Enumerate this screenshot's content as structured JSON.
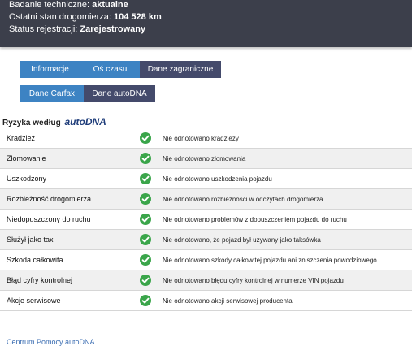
{
  "header": {
    "inspection_label": "Badanie techniczne:",
    "inspection_value": "aktualne",
    "odometer_label": "Ostatni stan drogomierza:",
    "odometer_value": "104 528 km",
    "registration_label": "Status rejestracji:",
    "registration_value": "Zarejestrowany"
  },
  "tabs_primary": [
    "Informacje",
    "Oś czasu",
    "Dane zagraniczne"
  ],
  "tabs_secondary": [
    "Dane Carfax",
    "Dane autoDNA"
  ],
  "section": {
    "title": "Ryzyka według",
    "brand": "autoDNA"
  },
  "risks": [
    {
      "label": "Kradzież",
      "status_icon": "check-circle-icon",
      "description": "Nie odnotowano kradzieży"
    },
    {
      "label": "Złomowanie",
      "status_icon": "check-circle-icon",
      "description": "Nie odnotowano złomowania"
    },
    {
      "label": "Uszkodzony",
      "status_icon": "check-circle-icon",
      "description": "Nie odnotowano uszkodzenia pojazdu"
    },
    {
      "label": "Rozbieżność drogomierza",
      "status_icon": "check-circle-icon",
      "description": "Nie odnotowano rozbieżności w odczytach drogomierza"
    },
    {
      "label": "Niedopuszczony do ruchu",
      "status_icon": "check-circle-icon",
      "description": "Nie odnotowano problemów z dopuszczeniem pojazdu do ruchu"
    },
    {
      "label": "Służył jako taxi",
      "status_icon": "check-circle-icon",
      "description": "Nie odnotowano, że pojazd był używany jako taksówka"
    },
    {
      "label": "Szkoda całkowita",
      "status_icon": "check-circle-icon",
      "description": "Nie odnotowano szkody całkowitej pojazdu ani zniszczenia powodziowego"
    },
    {
      "label": "Błąd cyfry kontrolnej",
      "status_icon": "check-circle-icon",
      "description": "Nie odnotowano błędu cyfry kontrolnej w numerze VIN pojazdu"
    },
    {
      "label": "Akcje serwisowe",
      "status_icon": "check-circle-icon",
      "description": "Nie odnotowano akcji serwisowej producenta"
    }
  ],
  "footer": {
    "help_link": "Centrum Pomocy autoDNA"
  },
  "colors": {
    "header_bg": "#3c3f4b",
    "tab_blue": "#3d83c3",
    "tab_dark": "#444a6b",
    "check_green": "#3aa54a",
    "brand_blue": "#1f3d7a"
  }
}
